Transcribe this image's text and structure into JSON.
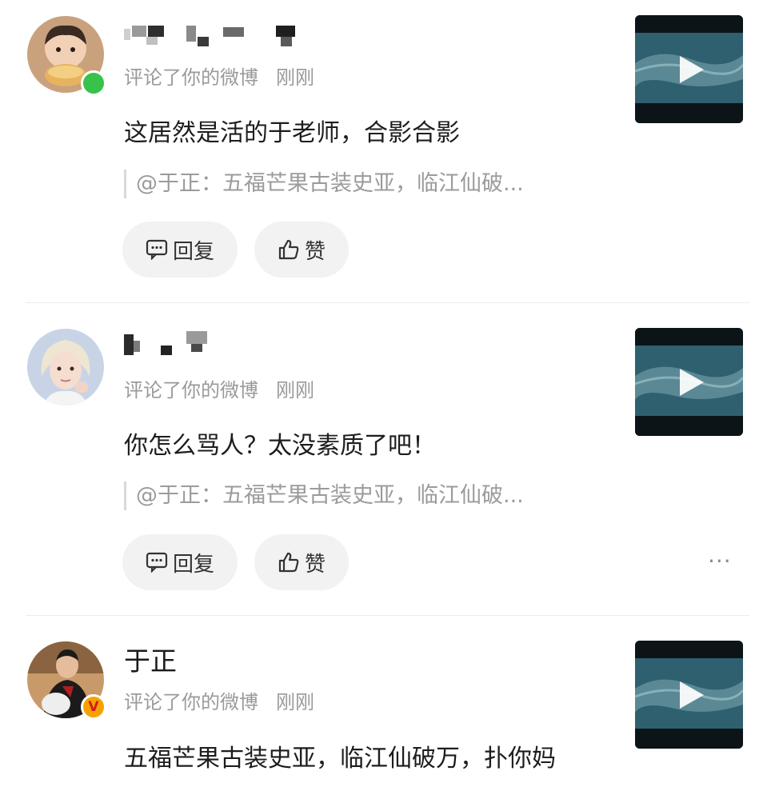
{
  "icons": {
    "reply": "reply-icon",
    "like": "thumbs-up-icon",
    "play": "play-icon",
    "more": "more-dots-icon",
    "online": "online-dot-icon",
    "verified": "verified-v-icon"
  },
  "colors": {
    "online": "#37c24a",
    "verified": "#f5a200",
    "button_bg": "#f2f2f2",
    "meta_text": "#9a9a9a"
  },
  "notifications": [
    {
      "name": "",
      "action": "评论了你的微博",
      "time": "刚刚",
      "content": "这居然是活的于老师，合影合影",
      "quote": "@于正：五福芒果古装史亚，临江仙破...",
      "reply_label": "回复",
      "like_label": "赞"
    },
    {
      "name": "",
      "action": "评论了你的微博",
      "time": "刚刚",
      "content": "你怎么骂人？太没素质了吧！",
      "quote": "@于正：五福芒果古装史亚，临江仙破...",
      "reply_label": "回复",
      "like_label": "赞",
      "more": "···"
    },
    {
      "name": "于正",
      "action": "评论了你的微博",
      "time": "刚刚",
      "content": "五福芒果古装史亚，临江仙破万，扑你妈",
      "verified_mark": "V"
    }
  ]
}
